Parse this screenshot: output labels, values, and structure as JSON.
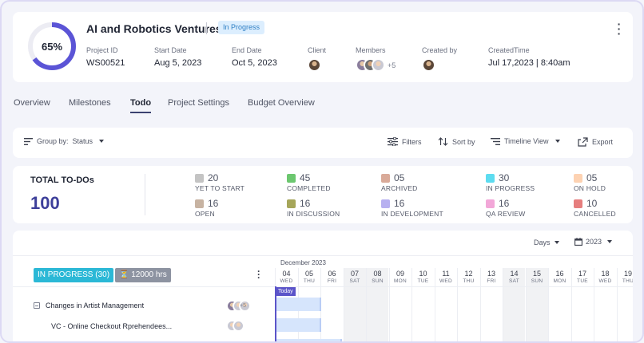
{
  "project": {
    "progress_label": "65%",
    "progress": 0.65,
    "title": "AI and Robotics Ventures",
    "status": "In Progress",
    "fields": {
      "id_label": "Project ID",
      "id_value": "WS00521",
      "start_label": "Start Date",
      "start_value": "Aug 5, 2023",
      "end_label": "End Date",
      "end_value": "Oct 5, 2023",
      "client_label": "Client",
      "members_label": "Members",
      "members_more": "+5",
      "created_by_label": "Created by",
      "created_time_label": "CreatedTime",
      "created_time_value": "Jul 17,2023 | 8:40am"
    }
  },
  "tabs": [
    "Overview",
    "Milestones",
    "Todo",
    "Project Settings",
    "Budget Overview"
  ],
  "toolbar": {
    "group_by": "Group by:",
    "group_value": "Status",
    "filters": "Filters",
    "sort_by": "Sort by",
    "timeline_view": "Timeline View",
    "export": "Export"
  },
  "totals": {
    "label": "TOTAL TO-DOs",
    "value": "100"
  },
  "stats": [
    {
      "count": "20",
      "label": "YET TO START",
      "color": "#c4c4c4"
    },
    {
      "count": "45",
      "label": "COMPLETED",
      "color": "#6cc76f"
    },
    {
      "count": "05",
      "label": "ARCHIVED",
      "color": "#d9aa99"
    },
    {
      "count": "30",
      "label": "IN PROGRESS",
      "color": "#5ddcf0"
    },
    {
      "count": "05",
      "label": "ON HOLD",
      "color": "#fdd2b2"
    },
    {
      "count": "16",
      "label": "OPEN",
      "color": "#c7b3a2"
    },
    {
      "count": "16",
      "label": "IN DISCUSSION",
      "color": "#a6a65a"
    },
    {
      "count": "16",
      "label": "IN DEVELOPMENT",
      "color": "#b7b0f0"
    },
    {
      "count": "16",
      "label": "QA REVIEW",
      "color": "#f2a7d8"
    },
    {
      "count": "10",
      "label": "CANCELLED",
      "color": "#e67e7e"
    }
  ],
  "gantt": {
    "days_select": "Days",
    "year_select": "2023",
    "month": "December 2023",
    "group_label": "IN PROGRESS (30)",
    "hours_label": "12000 hrs",
    "today": "Today",
    "tasks": [
      {
        "name": "Changes in Artist Management",
        "more": "+5"
      },
      {
        "name": "VC - Online Checkout Rprehendees..."
      }
    ],
    "days": [
      {
        "d": "04",
        "w": "WED",
        "we": false
      },
      {
        "d": "05",
        "w": "THU",
        "we": false
      },
      {
        "d": "06",
        "w": "FRI",
        "we": false
      },
      {
        "d": "07",
        "w": "SAT",
        "we": true
      },
      {
        "d": "08",
        "w": "SUN",
        "we": true
      },
      {
        "d": "09",
        "w": "MON",
        "we": false
      },
      {
        "d": "10",
        "w": "TUE",
        "we": false
      },
      {
        "d": "11",
        "w": "WED",
        "we": false
      },
      {
        "d": "12",
        "w": "THU",
        "we": false
      },
      {
        "d": "13",
        "w": "FRI",
        "we": false
      },
      {
        "d": "14",
        "w": "SAT",
        "we": true
      },
      {
        "d": "15",
        "w": "SUN",
        "we": true
      },
      {
        "d": "16",
        "w": "MON",
        "we": false
      },
      {
        "d": "17",
        "w": "TUE",
        "we": false
      },
      {
        "d": "18",
        "w": "WED",
        "we": false
      },
      {
        "d": "19",
        "w": "THU",
        "we": false
      }
    ]
  }
}
